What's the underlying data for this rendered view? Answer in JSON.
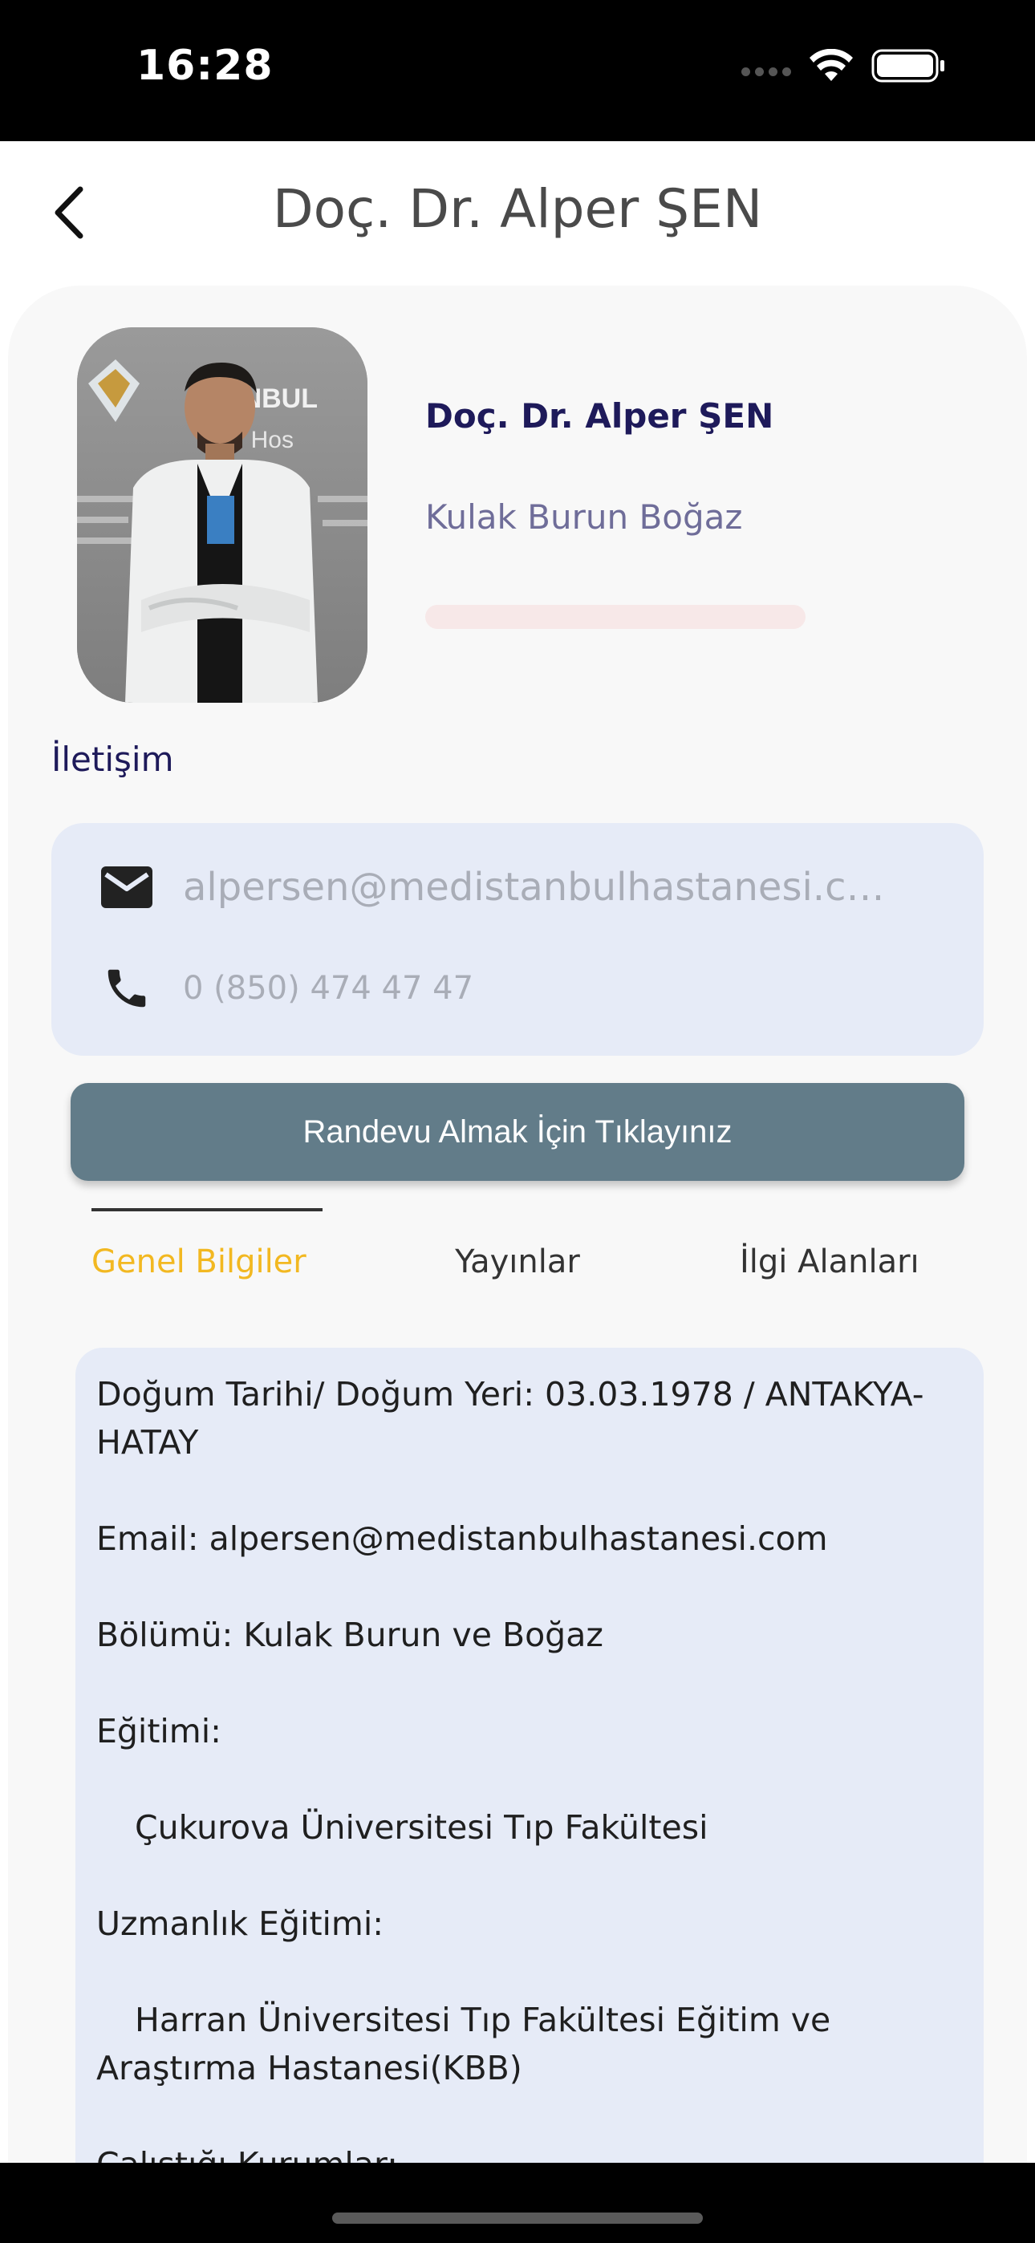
{
  "status_bar": {
    "time": "16:28"
  },
  "nav": {
    "title": "Doç. Dr. Alper ŞEN",
    "back_icon": "chevron-left-icon"
  },
  "profile": {
    "name": "Doç. Dr. Alper ŞEN",
    "department": "Kulak Burun Boğaz",
    "photo_backdrop_text": "MEDISTANBUL Hospital"
  },
  "contact": {
    "heading": "İletişim",
    "email": "alpersen@medistanbulhastanesi.com",
    "phone": "0 (850) 474 47 47",
    "email_icon": "mail-icon",
    "phone_icon": "phone-icon"
  },
  "appointment_button": {
    "label": "Randevu Almak İçin Tıklayınız"
  },
  "tabs": [
    {
      "label": "Genel Bilgiler",
      "active": true
    },
    {
      "label": "Yayınlar",
      "active": false
    },
    {
      "label": "İlgi Alanları",
      "active": false
    }
  ],
  "general_info": {
    "birth": "Doğum Tarihi/ Doğum Yeri: 03.03.1978 / ANTAKYA-HATAY",
    "email": "Email: alpersen@medistanbulhastanesi.com",
    "department": "Bölümü: Kulak Burun ve Boğaz",
    "education_label": "Eğitimi:",
    "education_value": "Çukurova Üniversitesi Tıp Fakültesi",
    "specialty_label": "Uzmanlık Eğitimi:",
    "specialty_value": "Harran Üniversitesi Tıp Fakültesi Eğitim ve Araştırma Hastanesi(KBB)",
    "institutions_label": "Çalıştığı Kurumlar:"
  },
  "colors": {
    "accent_tab": "#f2b821",
    "button": "#627c89",
    "name": "#1e1a5a",
    "contact_bg": "#e6ebf7"
  }
}
